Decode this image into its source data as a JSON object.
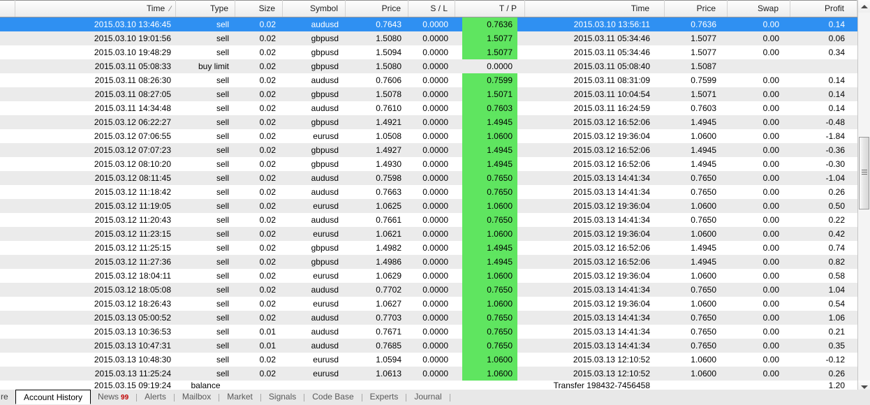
{
  "grid": {
    "columns": [
      {
        "key": "mark",
        "label": ""
      },
      {
        "key": "time",
        "label": "Time",
        "sorted": true,
        "sort_glyph": "∕"
      },
      {
        "key": "type",
        "label": "Type"
      },
      {
        "key": "size",
        "label": "Size"
      },
      {
        "key": "symbol",
        "label": "Symbol"
      },
      {
        "key": "price",
        "label": "Price"
      },
      {
        "key": "sl",
        "label": "S / L"
      },
      {
        "key": "tp",
        "label": "T / P"
      },
      {
        "key": "ctime",
        "label": "Time"
      },
      {
        "key": "cprice",
        "label": "Price"
      },
      {
        "key": "swap",
        "label": "Swap"
      },
      {
        "key": "profit",
        "label": "Profit"
      }
    ],
    "selected_row_index": 0,
    "rows": [
      {
        "time": "2015.03.10 13:46:45",
        "type": "sell",
        "size": "0.02",
        "symbol": "audusd",
        "price": "0.7643",
        "sl": "0.0000",
        "tp": "0.7636",
        "tp_highlight": true,
        "ctime": "2015.03.10 13:56:11",
        "cprice": "0.7636",
        "swap": "0.00",
        "profit": "0.14"
      },
      {
        "time": "2015.03.10 19:01:56",
        "type": "sell",
        "size": "0.02",
        "symbol": "gbpusd",
        "price": "1.5080",
        "sl": "0.0000",
        "tp": "1.5077",
        "tp_highlight": true,
        "ctime": "2015.03.11 05:34:46",
        "cprice": "1.5077",
        "swap": "0.00",
        "profit": "0.06"
      },
      {
        "time": "2015.03.10 19:48:29",
        "type": "sell",
        "size": "0.02",
        "symbol": "gbpusd",
        "price": "1.5094",
        "sl": "0.0000",
        "tp": "1.5077",
        "tp_highlight": true,
        "ctime": "2015.03.11 05:34:46",
        "cprice": "1.5077",
        "swap": "0.00",
        "profit": "0.34"
      },
      {
        "time": "2015.03.11 05:08:33",
        "type": "buy limit",
        "size": "0.02",
        "symbol": "gbpusd",
        "price": "1.5080",
        "sl": "0.0000",
        "tp": "0.0000",
        "tp_highlight": false,
        "ctime": "2015.03.11 05:08:40",
        "cprice": "1.5087",
        "swap": "",
        "profit": ""
      },
      {
        "time": "2015.03.11 08:26:30",
        "type": "sell",
        "size": "0.02",
        "symbol": "audusd",
        "price": "0.7606",
        "sl": "0.0000",
        "tp": "0.7599",
        "tp_highlight": true,
        "ctime": "2015.03.11 08:31:09",
        "cprice": "0.7599",
        "swap": "0.00",
        "profit": "0.14"
      },
      {
        "time": "2015.03.11 08:27:05",
        "type": "sell",
        "size": "0.02",
        "symbol": "gbpusd",
        "price": "1.5078",
        "sl": "0.0000",
        "tp": "1.5071",
        "tp_highlight": true,
        "ctime": "2015.03.11 10:04:54",
        "cprice": "1.5071",
        "swap": "0.00",
        "profit": "0.14"
      },
      {
        "time": "2015.03.11 14:34:48",
        "type": "sell",
        "size": "0.02",
        "symbol": "audusd",
        "price": "0.7610",
        "sl": "0.0000",
        "tp": "0.7603",
        "tp_highlight": true,
        "ctime": "2015.03.11 16:24:59",
        "cprice": "0.7603",
        "swap": "0.00",
        "profit": "0.14"
      },
      {
        "time": "2015.03.12 06:22:27",
        "type": "sell",
        "size": "0.02",
        "symbol": "gbpusd",
        "price": "1.4921",
        "sl": "0.0000",
        "tp": "1.4945",
        "tp_highlight": true,
        "ctime": "2015.03.12 16:52:06",
        "cprice": "1.4945",
        "swap": "0.00",
        "profit": "-0.48"
      },
      {
        "time": "2015.03.12 07:06:55",
        "type": "sell",
        "size": "0.02",
        "symbol": "eurusd",
        "price": "1.0508",
        "sl": "0.0000",
        "tp": "1.0600",
        "tp_highlight": true,
        "ctime": "2015.03.12 19:36:04",
        "cprice": "1.0600",
        "swap": "0.00",
        "profit": "-1.84"
      },
      {
        "time": "2015.03.12 07:07:23",
        "type": "sell",
        "size": "0.02",
        "symbol": "gbpusd",
        "price": "1.4927",
        "sl": "0.0000",
        "tp": "1.4945",
        "tp_highlight": true,
        "ctime": "2015.03.12 16:52:06",
        "cprice": "1.4945",
        "swap": "0.00",
        "profit": "-0.36"
      },
      {
        "time": "2015.03.12 08:10:20",
        "type": "sell",
        "size": "0.02",
        "symbol": "gbpusd",
        "price": "1.4930",
        "sl": "0.0000",
        "tp": "1.4945",
        "tp_highlight": true,
        "ctime": "2015.03.12 16:52:06",
        "cprice": "1.4945",
        "swap": "0.00",
        "profit": "-0.30"
      },
      {
        "time": "2015.03.12 08:11:45",
        "type": "sell",
        "size": "0.02",
        "symbol": "audusd",
        "price": "0.7598",
        "sl": "0.0000",
        "tp": "0.7650",
        "tp_highlight": true,
        "ctime": "2015.03.13 14:41:34",
        "cprice": "0.7650",
        "swap": "0.00",
        "profit": "-1.04"
      },
      {
        "time": "2015.03.12 11:18:42",
        "type": "sell",
        "size": "0.02",
        "symbol": "audusd",
        "price": "0.7663",
        "sl": "0.0000",
        "tp": "0.7650",
        "tp_highlight": true,
        "ctime": "2015.03.13 14:41:34",
        "cprice": "0.7650",
        "swap": "0.00",
        "profit": "0.26"
      },
      {
        "time": "2015.03.12 11:19:05",
        "type": "sell",
        "size": "0.02",
        "symbol": "eurusd",
        "price": "1.0625",
        "sl": "0.0000",
        "tp": "1.0600",
        "tp_highlight": true,
        "ctime": "2015.03.12 19:36:04",
        "cprice": "1.0600",
        "swap": "0.00",
        "profit": "0.50"
      },
      {
        "time": "2015.03.12 11:20:43",
        "type": "sell",
        "size": "0.02",
        "symbol": "audusd",
        "price": "0.7661",
        "sl": "0.0000",
        "tp": "0.7650",
        "tp_highlight": true,
        "ctime": "2015.03.13 14:41:34",
        "cprice": "0.7650",
        "swap": "0.00",
        "profit": "0.22"
      },
      {
        "time": "2015.03.12 11:23:15",
        "type": "sell",
        "size": "0.02",
        "symbol": "eurusd",
        "price": "1.0621",
        "sl": "0.0000",
        "tp": "1.0600",
        "tp_highlight": true,
        "ctime": "2015.03.12 19:36:04",
        "cprice": "1.0600",
        "swap": "0.00",
        "profit": "0.42"
      },
      {
        "time": "2015.03.12 11:25:15",
        "type": "sell",
        "size": "0.02",
        "symbol": "gbpusd",
        "price": "1.4982",
        "sl": "0.0000",
        "tp": "1.4945",
        "tp_highlight": true,
        "ctime": "2015.03.12 16:52:06",
        "cprice": "1.4945",
        "swap": "0.00",
        "profit": "0.74"
      },
      {
        "time": "2015.03.12 11:27:36",
        "type": "sell",
        "size": "0.02",
        "symbol": "gbpusd",
        "price": "1.4986",
        "sl": "0.0000",
        "tp": "1.4945",
        "tp_highlight": true,
        "ctime": "2015.03.12 16:52:06",
        "cprice": "1.4945",
        "swap": "0.00",
        "profit": "0.82"
      },
      {
        "time": "2015.03.12 18:04:11",
        "type": "sell",
        "size": "0.02",
        "symbol": "eurusd",
        "price": "1.0629",
        "sl": "0.0000",
        "tp": "1.0600",
        "tp_highlight": true,
        "ctime": "2015.03.12 19:36:04",
        "cprice": "1.0600",
        "swap": "0.00",
        "profit": "0.58"
      },
      {
        "time": "2015.03.12 18:05:08",
        "type": "sell",
        "size": "0.02",
        "symbol": "audusd",
        "price": "0.7702",
        "sl": "0.0000",
        "tp": "0.7650",
        "tp_highlight": true,
        "ctime": "2015.03.13 14:41:34",
        "cprice": "0.7650",
        "swap": "0.00",
        "profit": "1.04"
      },
      {
        "time": "2015.03.12 18:26:43",
        "type": "sell",
        "size": "0.02",
        "symbol": "eurusd",
        "price": "1.0627",
        "sl": "0.0000",
        "tp": "1.0600",
        "tp_highlight": true,
        "ctime": "2015.03.12 19:36:04",
        "cprice": "1.0600",
        "swap": "0.00",
        "profit": "0.54"
      },
      {
        "time": "2015.03.13 05:00:52",
        "type": "sell",
        "size": "0.02",
        "symbol": "audusd",
        "price": "0.7703",
        "sl": "0.0000",
        "tp": "0.7650",
        "tp_highlight": true,
        "ctime": "2015.03.13 14:41:34",
        "cprice": "0.7650",
        "swap": "0.00",
        "profit": "1.06"
      },
      {
        "time": "2015.03.13 10:36:53",
        "type": "sell",
        "size": "0.01",
        "symbol": "audusd",
        "price": "0.7671",
        "sl": "0.0000",
        "tp": "0.7650",
        "tp_highlight": true,
        "ctime": "2015.03.13 14:41:34",
        "cprice": "0.7650",
        "swap": "0.00",
        "profit": "0.21"
      },
      {
        "time": "2015.03.13 10:47:31",
        "type": "sell",
        "size": "0.01",
        "symbol": "audusd",
        "price": "0.7685",
        "sl": "0.0000",
        "tp": "0.7650",
        "tp_highlight": true,
        "ctime": "2015.03.13 14:41:34",
        "cprice": "0.7650",
        "swap": "0.00",
        "profit": "0.35"
      },
      {
        "time": "2015.03.13 10:48:30",
        "type": "sell",
        "size": "0.02",
        "symbol": "eurusd",
        "price": "1.0594",
        "sl": "0.0000",
        "tp": "1.0600",
        "tp_highlight": true,
        "ctime": "2015.03.13 12:10:52",
        "cprice": "1.0600",
        "swap": "0.00",
        "profit": "-0.12"
      },
      {
        "time": "2015.03.13 11:25:24",
        "type": "sell",
        "size": "0.02",
        "symbol": "eurusd",
        "price": "1.0613",
        "sl": "0.0000",
        "tp": "1.0600",
        "tp_highlight": true,
        "ctime": "2015.03.13 12:10:52",
        "cprice": "1.0600",
        "swap": "0.00",
        "profit": "0.26"
      }
    ],
    "balance_row": {
      "time": "2015.03.15 09:19:24",
      "type": "balance",
      "ctime": "Transfer 198432-7456458",
      "profit": "1.20"
    }
  },
  "scrollbar": {
    "up_icon": "scroll-up-arrow",
    "down_icon": "scroll-down-arrow"
  },
  "tabbar": {
    "prev_label": "re",
    "active_tab": "Account History",
    "tabs": [
      {
        "label": "News",
        "badge": "99"
      },
      {
        "label": "Alerts",
        "badge": ""
      },
      {
        "label": "Mailbox",
        "badge": ""
      },
      {
        "label": "Market",
        "badge": ""
      },
      {
        "label": "Signals",
        "badge": ""
      },
      {
        "label": "Code Base",
        "badge": ""
      },
      {
        "label": "Experts",
        "badge": ""
      },
      {
        "label": "Journal",
        "badge": ""
      }
    ]
  },
  "colors": {
    "selection": "#2f90f2",
    "tp_highlight": "#5fe560",
    "row_alt": "#ebebeb",
    "badge": "#c00000"
  }
}
